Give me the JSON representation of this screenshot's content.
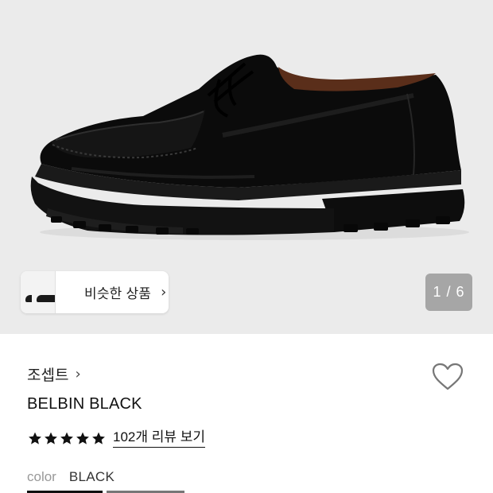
{
  "gallery": {
    "image_icon": "black-leather-derby-shoe",
    "similar_label": "비슷한 상품",
    "similar_arrow": "›",
    "counter": "1 / 6"
  },
  "product": {
    "brand": "조셉트",
    "brand_arrow": "›",
    "name": "BELBIN BLACK",
    "rating_stars": 5,
    "review_link": "102개 리뷰 보기",
    "color_key": "color",
    "color_value": "BLACK"
  },
  "colors": {
    "star": "#111111",
    "counter_bg": "#6e6e6e",
    "gallery_bg": "#ebebeb"
  }
}
